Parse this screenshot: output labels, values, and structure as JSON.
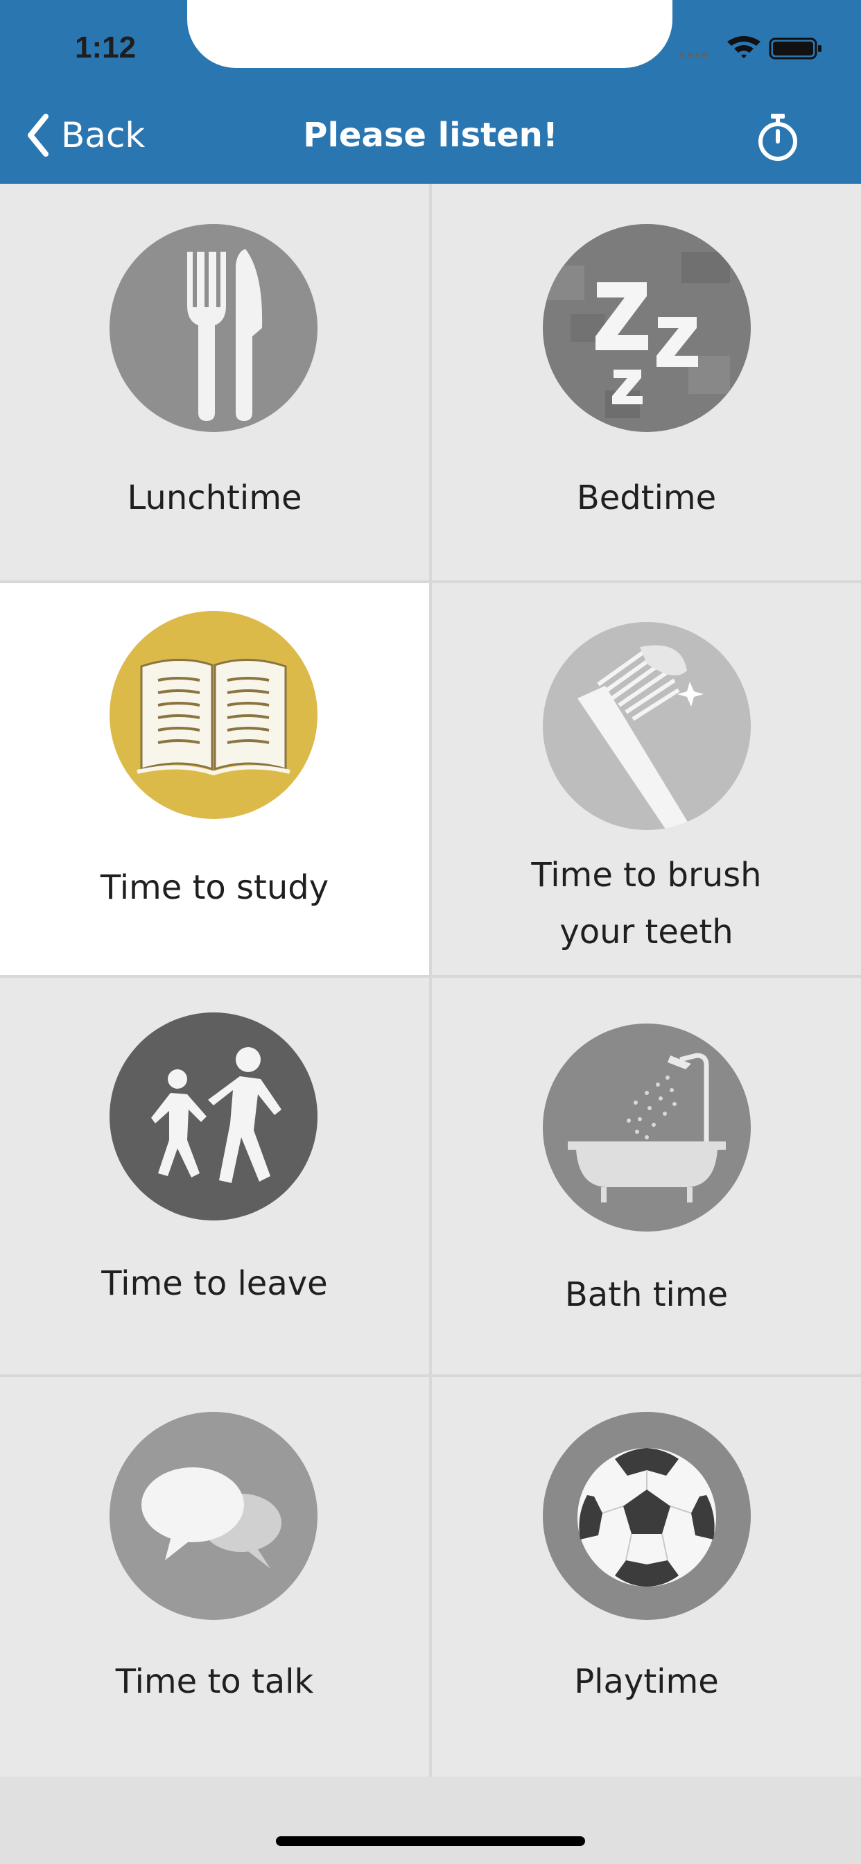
{
  "status_bar": {
    "time": "1:12"
  },
  "nav": {
    "back_label": "Back",
    "title": "Please listen!",
    "timer_icon": "stopwatch-icon"
  },
  "colors": {
    "nav_bg": "#2a76b1",
    "selected_circle": "#dcba4a",
    "cell_bg": "#e8e8e8",
    "selected_bg": "#ffffff"
  },
  "items": [
    {
      "label": "Lunchtime",
      "icon": "fork-knife-icon",
      "selected": false
    },
    {
      "label": "Bedtime",
      "icon": "sleep-zzz-icon",
      "selected": false
    },
    {
      "label": "Time to study",
      "icon": "open-book-icon",
      "selected": true
    },
    {
      "label_line1": "Time to brush",
      "label_line2": "your teeth",
      "icon": "toothbrush-icon",
      "selected": false
    },
    {
      "label": "Time to leave",
      "icon": "walking-people-icon",
      "selected": false
    },
    {
      "label": "Bath time",
      "icon": "bathtub-icon",
      "selected": false
    },
    {
      "label": "Time to talk",
      "icon": "speech-bubbles-icon",
      "selected": false
    },
    {
      "label": "Playtime",
      "icon": "soccer-ball-icon",
      "selected": false
    }
  ]
}
